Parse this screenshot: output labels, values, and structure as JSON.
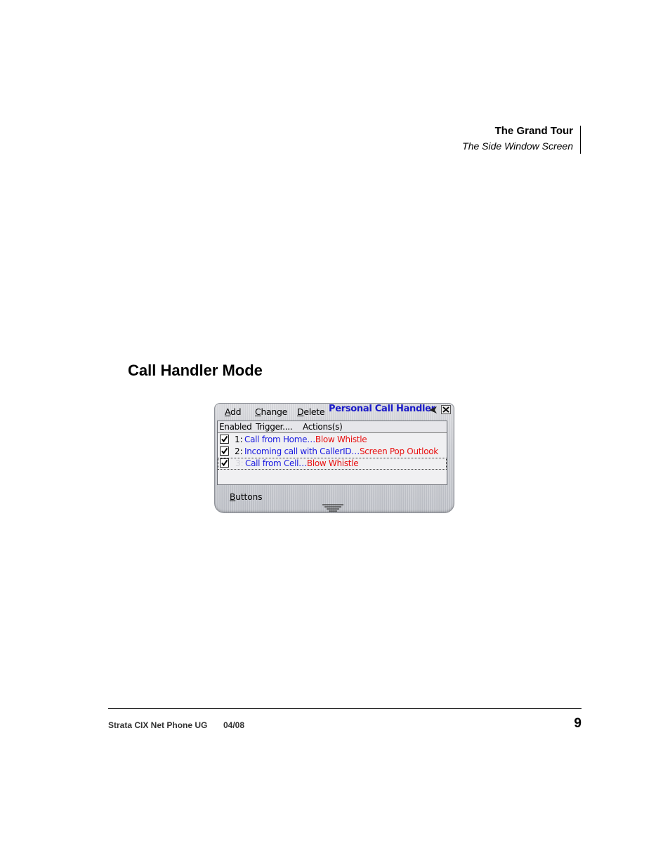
{
  "header": {
    "title": "The Grand Tour",
    "subtitle": "The Side Window Screen"
  },
  "section": {
    "title": "Call Handler Mode"
  },
  "widget": {
    "menu": {
      "add": {
        "first": "A",
        "rest": "dd"
      },
      "change": {
        "first": "C",
        "rest": "hange"
      },
      "delete": {
        "first": "D",
        "rest": "elete"
      }
    },
    "title": "Personal Call Handler",
    "icons": {
      "collapse": "left-arrow-icon",
      "close": "close-icon",
      "grip": "drag-grip-icon"
    },
    "columns": {
      "enabled": "Enabled",
      "trigger": "Trigger....",
      "actions": "Actions(s)"
    },
    "rows": [
      {
        "num": "1:",
        "trigger": "Call from Home…",
        "action": "Blow Whistle",
        "enabled": true
      },
      {
        "num": "2:",
        "trigger": "Incoming call with CallerID…",
        "action": "Screen Pop Outlook",
        "enabled": true
      },
      {
        "num": "3:",
        "trigger": "Call from Cell…",
        "action": "Blow Whistle",
        "enabled": true
      }
    ],
    "buttons_label": {
      "first": "B",
      "rest": "uttons"
    },
    "colors": {
      "trigger": "#1a1ae0",
      "action": "#e81010",
      "title": "#1a1ac8"
    }
  },
  "footer": {
    "doc": "Strata CIX Net Phone UG",
    "date": "04/08",
    "page": "9"
  }
}
